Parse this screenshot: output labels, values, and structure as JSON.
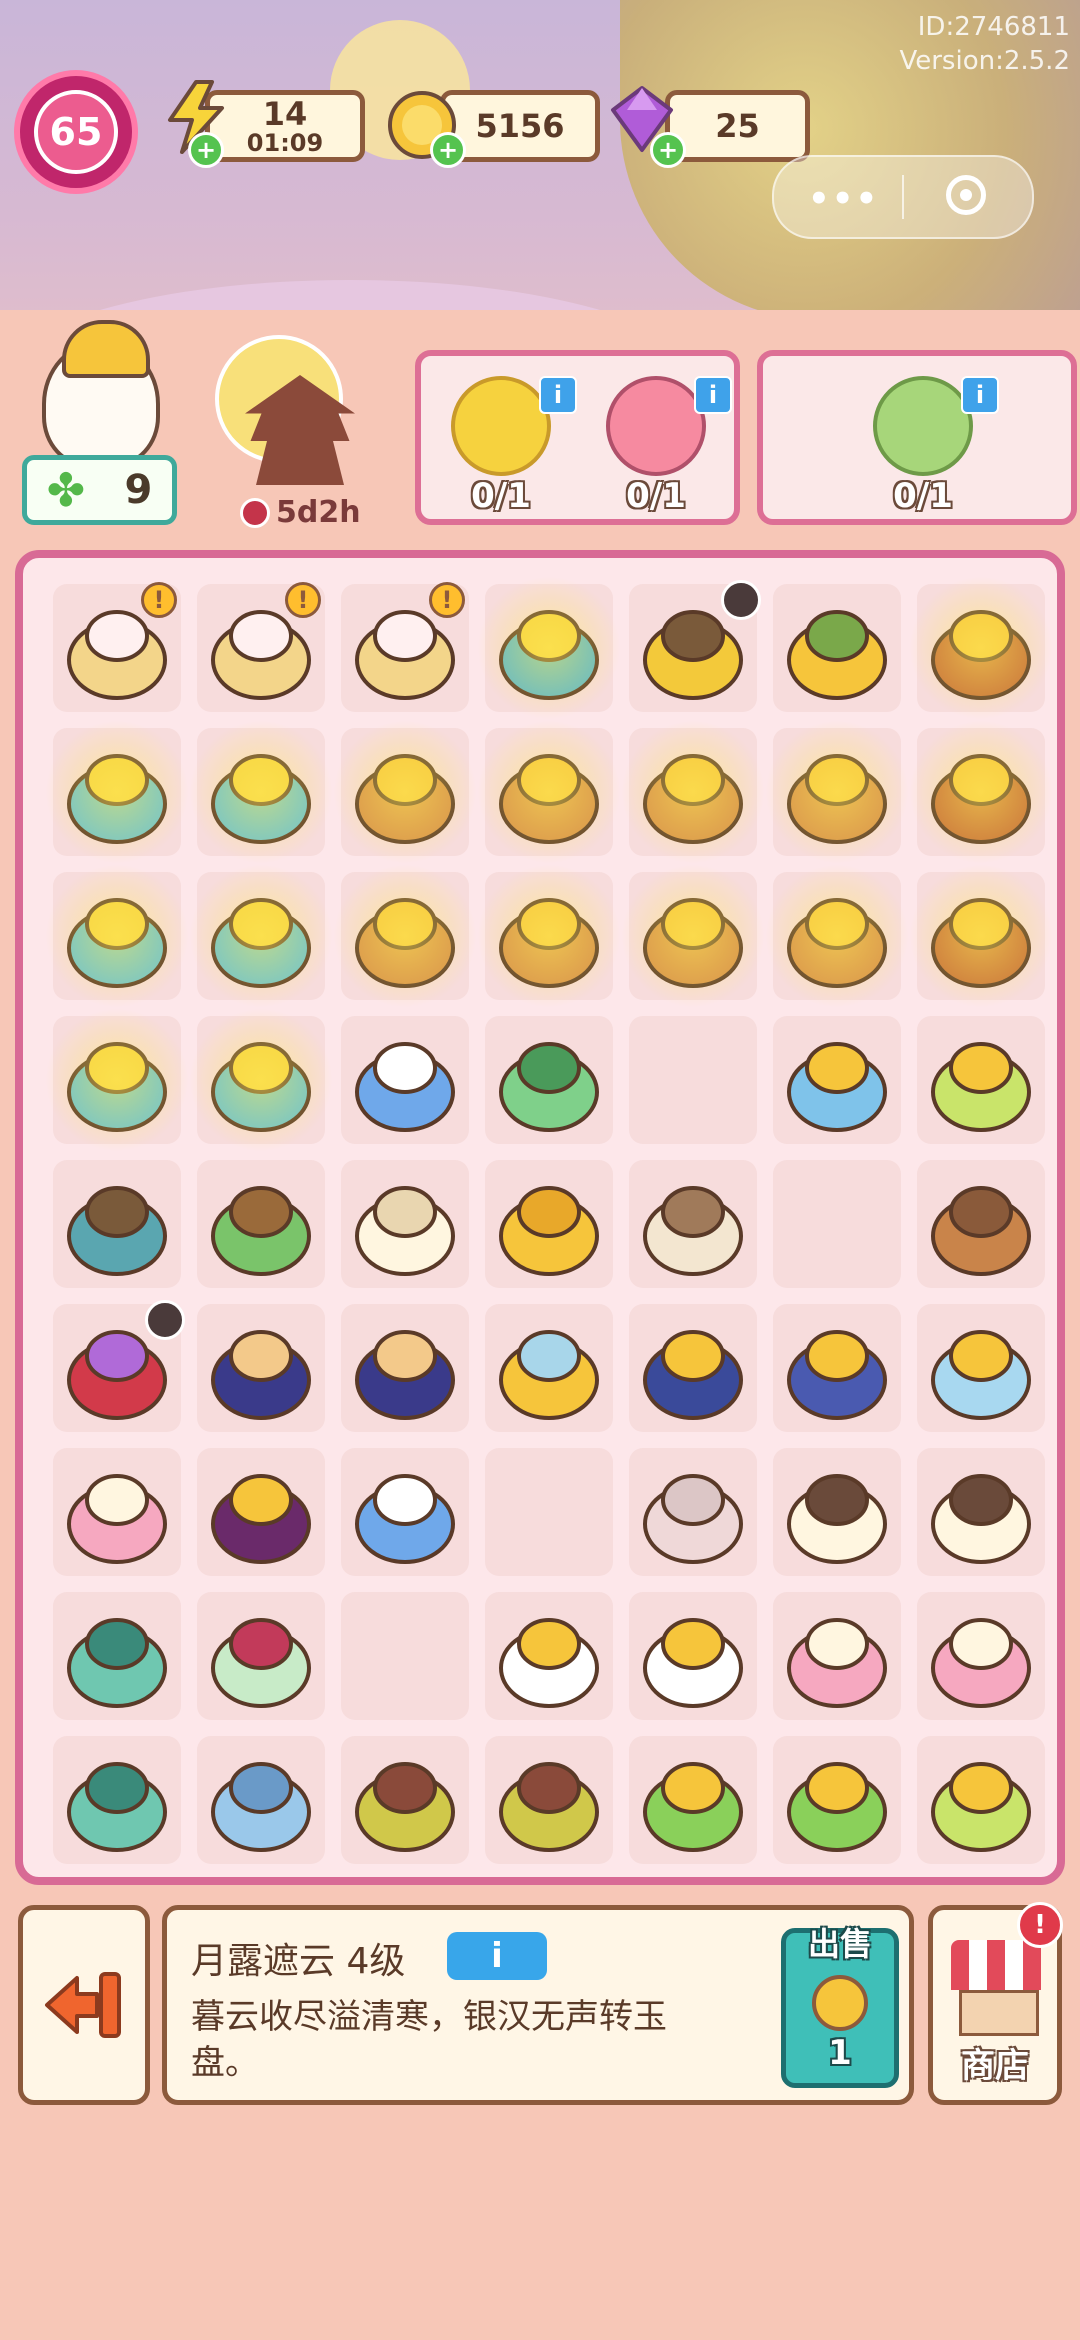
{
  "meta": {
    "id": "ID:2746811",
    "version": "Version:2.5.2"
  },
  "player": {
    "level": "65"
  },
  "energy": {
    "value": "14",
    "timer": "01:09",
    "icon": "lightning-icon"
  },
  "coins": {
    "value": "5156",
    "icon": "coin-icon"
  },
  "gems": {
    "value": "25",
    "icon": "gem-icon"
  },
  "helper": {
    "clover_count": "9"
  },
  "event": {
    "time_left": "5d2h"
  },
  "orders": [
    {
      "items": [
        {
          "name": "golden-mooncake",
          "count": "0/1"
        },
        {
          "name": "pink-flower-cake",
          "count": "0/1"
        }
      ]
    },
    {
      "items": [
        {
          "name": "green-mooncake",
          "count": "0/1"
        }
      ]
    }
  ],
  "board": {
    "rows": [
      [
        "bunny-mortar",
        "bunny-mortar",
        "bunny-mortar",
        "lantern-tree",
        "osmanthus-tree",
        "osmanthus-branch",
        "osmanthus-basket"
      ],
      [
        "cloud-tree",
        "cloud-tree",
        "wooden-rack",
        "wooden-rack",
        "wooden-rack",
        "wooden-rack",
        "osmanthus-basket"
      ],
      [
        "cloud-tree",
        "cloud-tree",
        "wooden-rack",
        "wooden-rack",
        "wooden-rack",
        "wooden-rack",
        "osmanthus-basket"
      ],
      [
        "cloud-tree",
        "cloud-tree",
        "infinity-crystal",
        "green-tray",
        "empty",
        "star-plate",
        "osmanthus-soup"
      ],
      [
        "pine-tree",
        "sprout",
        "cloud",
        "gold-stars",
        "thread-spool",
        "empty",
        "bread-loaves"
      ],
      [
        "red-cauldron",
        "honey-jars",
        "honey-jars",
        "moon-cloud",
        "starry-jar",
        "starry-cup",
        "star-bottles"
      ],
      [
        "bunny-cupcake",
        "wine-bottle",
        "hourglass-crystal",
        "empty",
        "moon-slot",
        "sake-set",
        "sake-set"
      ],
      [
        "jade-plate",
        "dice",
        "empty",
        "tea-bowl",
        "tea-bowl",
        "bunny-cupcake",
        "bunny-cupcake"
      ],
      [
        "jade-plate",
        "blue-seed",
        "osmanthus-bowl",
        "osmanthus-bowl",
        "bamboo-cup",
        "bamboo-cup",
        "osmanthus-soup"
      ]
    ]
  },
  "selected_item": {
    "name": "月露遮云 4级",
    "info_label": "i",
    "description": "暮云收尽溢清寒，银汉无声转玉盘。",
    "sell_label": "出售",
    "sell_price": "1"
  },
  "shop": {
    "label": "商店",
    "badge": "!"
  },
  "colors": {
    "accent": "#d86a95",
    "board_bg": "#fde7ea",
    "gold": "#f6c53b",
    "teal": "#3fbfb8"
  }
}
